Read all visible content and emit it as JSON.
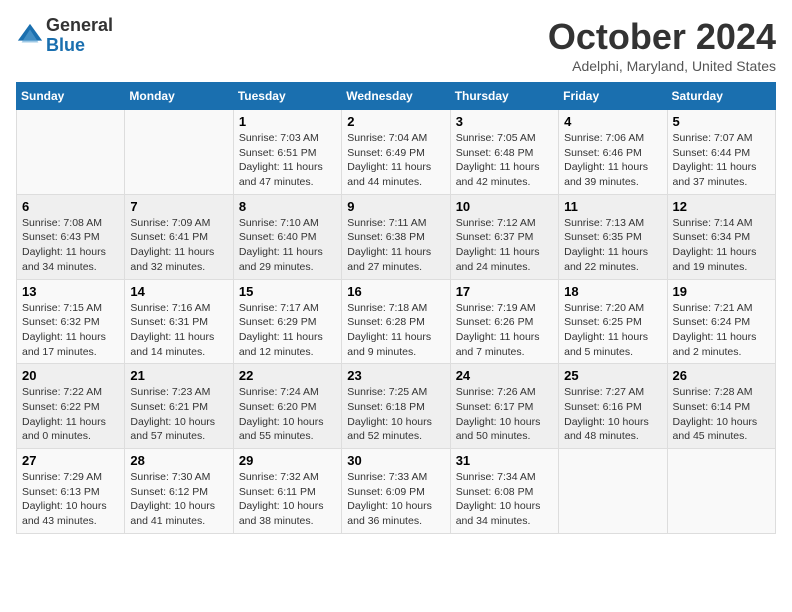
{
  "logo": {
    "general": "General",
    "blue": "Blue"
  },
  "title": "October 2024",
  "location": "Adelphi, Maryland, United States",
  "days_header": [
    "Sunday",
    "Monday",
    "Tuesday",
    "Wednesday",
    "Thursday",
    "Friday",
    "Saturday"
  ],
  "weeks": [
    [
      {
        "day": "",
        "sunrise": "",
        "sunset": "",
        "daylight": ""
      },
      {
        "day": "",
        "sunrise": "",
        "sunset": "",
        "daylight": ""
      },
      {
        "day": "1",
        "sunrise": "Sunrise: 7:03 AM",
        "sunset": "Sunset: 6:51 PM",
        "daylight": "Daylight: 11 hours and 47 minutes."
      },
      {
        "day": "2",
        "sunrise": "Sunrise: 7:04 AM",
        "sunset": "Sunset: 6:49 PM",
        "daylight": "Daylight: 11 hours and 44 minutes."
      },
      {
        "day": "3",
        "sunrise": "Sunrise: 7:05 AM",
        "sunset": "Sunset: 6:48 PM",
        "daylight": "Daylight: 11 hours and 42 minutes."
      },
      {
        "day": "4",
        "sunrise": "Sunrise: 7:06 AM",
        "sunset": "Sunset: 6:46 PM",
        "daylight": "Daylight: 11 hours and 39 minutes."
      },
      {
        "day": "5",
        "sunrise": "Sunrise: 7:07 AM",
        "sunset": "Sunset: 6:44 PM",
        "daylight": "Daylight: 11 hours and 37 minutes."
      }
    ],
    [
      {
        "day": "6",
        "sunrise": "Sunrise: 7:08 AM",
        "sunset": "Sunset: 6:43 PM",
        "daylight": "Daylight: 11 hours and 34 minutes."
      },
      {
        "day": "7",
        "sunrise": "Sunrise: 7:09 AM",
        "sunset": "Sunset: 6:41 PM",
        "daylight": "Daylight: 11 hours and 32 minutes."
      },
      {
        "day": "8",
        "sunrise": "Sunrise: 7:10 AM",
        "sunset": "Sunset: 6:40 PM",
        "daylight": "Daylight: 11 hours and 29 minutes."
      },
      {
        "day": "9",
        "sunrise": "Sunrise: 7:11 AM",
        "sunset": "Sunset: 6:38 PM",
        "daylight": "Daylight: 11 hours and 27 minutes."
      },
      {
        "day": "10",
        "sunrise": "Sunrise: 7:12 AM",
        "sunset": "Sunset: 6:37 PM",
        "daylight": "Daylight: 11 hours and 24 minutes."
      },
      {
        "day": "11",
        "sunrise": "Sunrise: 7:13 AM",
        "sunset": "Sunset: 6:35 PM",
        "daylight": "Daylight: 11 hours and 22 minutes."
      },
      {
        "day": "12",
        "sunrise": "Sunrise: 7:14 AM",
        "sunset": "Sunset: 6:34 PM",
        "daylight": "Daylight: 11 hours and 19 minutes."
      }
    ],
    [
      {
        "day": "13",
        "sunrise": "Sunrise: 7:15 AM",
        "sunset": "Sunset: 6:32 PM",
        "daylight": "Daylight: 11 hours and 17 minutes."
      },
      {
        "day": "14",
        "sunrise": "Sunrise: 7:16 AM",
        "sunset": "Sunset: 6:31 PM",
        "daylight": "Daylight: 11 hours and 14 minutes."
      },
      {
        "day": "15",
        "sunrise": "Sunrise: 7:17 AM",
        "sunset": "Sunset: 6:29 PM",
        "daylight": "Daylight: 11 hours and 12 minutes."
      },
      {
        "day": "16",
        "sunrise": "Sunrise: 7:18 AM",
        "sunset": "Sunset: 6:28 PM",
        "daylight": "Daylight: 11 hours and 9 minutes."
      },
      {
        "day": "17",
        "sunrise": "Sunrise: 7:19 AM",
        "sunset": "Sunset: 6:26 PM",
        "daylight": "Daylight: 11 hours and 7 minutes."
      },
      {
        "day": "18",
        "sunrise": "Sunrise: 7:20 AM",
        "sunset": "Sunset: 6:25 PM",
        "daylight": "Daylight: 11 hours and 5 minutes."
      },
      {
        "day": "19",
        "sunrise": "Sunrise: 7:21 AM",
        "sunset": "Sunset: 6:24 PM",
        "daylight": "Daylight: 11 hours and 2 minutes."
      }
    ],
    [
      {
        "day": "20",
        "sunrise": "Sunrise: 7:22 AM",
        "sunset": "Sunset: 6:22 PM",
        "daylight": "Daylight: 11 hours and 0 minutes."
      },
      {
        "day": "21",
        "sunrise": "Sunrise: 7:23 AM",
        "sunset": "Sunset: 6:21 PM",
        "daylight": "Daylight: 10 hours and 57 minutes."
      },
      {
        "day": "22",
        "sunrise": "Sunrise: 7:24 AM",
        "sunset": "Sunset: 6:20 PM",
        "daylight": "Daylight: 10 hours and 55 minutes."
      },
      {
        "day": "23",
        "sunrise": "Sunrise: 7:25 AM",
        "sunset": "Sunset: 6:18 PM",
        "daylight": "Daylight: 10 hours and 52 minutes."
      },
      {
        "day": "24",
        "sunrise": "Sunrise: 7:26 AM",
        "sunset": "Sunset: 6:17 PM",
        "daylight": "Daylight: 10 hours and 50 minutes."
      },
      {
        "day": "25",
        "sunrise": "Sunrise: 7:27 AM",
        "sunset": "Sunset: 6:16 PM",
        "daylight": "Daylight: 10 hours and 48 minutes."
      },
      {
        "day": "26",
        "sunrise": "Sunrise: 7:28 AM",
        "sunset": "Sunset: 6:14 PM",
        "daylight": "Daylight: 10 hours and 45 minutes."
      }
    ],
    [
      {
        "day": "27",
        "sunrise": "Sunrise: 7:29 AM",
        "sunset": "Sunset: 6:13 PM",
        "daylight": "Daylight: 10 hours and 43 minutes."
      },
      {
        "day": "28",
        "sunrise": "Sunrise: 7:30 AM",
        "sunset": "Sunset: 6:12 PM",
        "daylight": "Daylight: 10 hours and 41 minutes."
      },
      {
        "day": "29",
        "sunrise": "Sunrise: 7:32 AM",
        "sunset": "Sunset: 6:11 PM",
        "daylight": "Daylight: 10 hours and 38 minutes."
      },
      {
        "day": "30",
        "sunrise": "Sunrise: 7:33 AM",
        "sunset": "Sunset: 6:09 PM",
        "daylight": "Daylight: 10 hours and 36 minutes."
      },
      {
        "day": "31",
        "sunrise": "Sunrise: 7:34 AM",
        "sunset": "Sunset: 6:08 PM",
        "daylight": "Daylight: 10 hours and 34 minutes."
      },
      {
        "day": "",
        "sunrise": "",
        "sunset": "",
        "daylight": ""
      },
      {
        "day": "",
        "sunrise": "",
        "sunset": "",
        "daylight": ""
      }
    ]
  ]
}
